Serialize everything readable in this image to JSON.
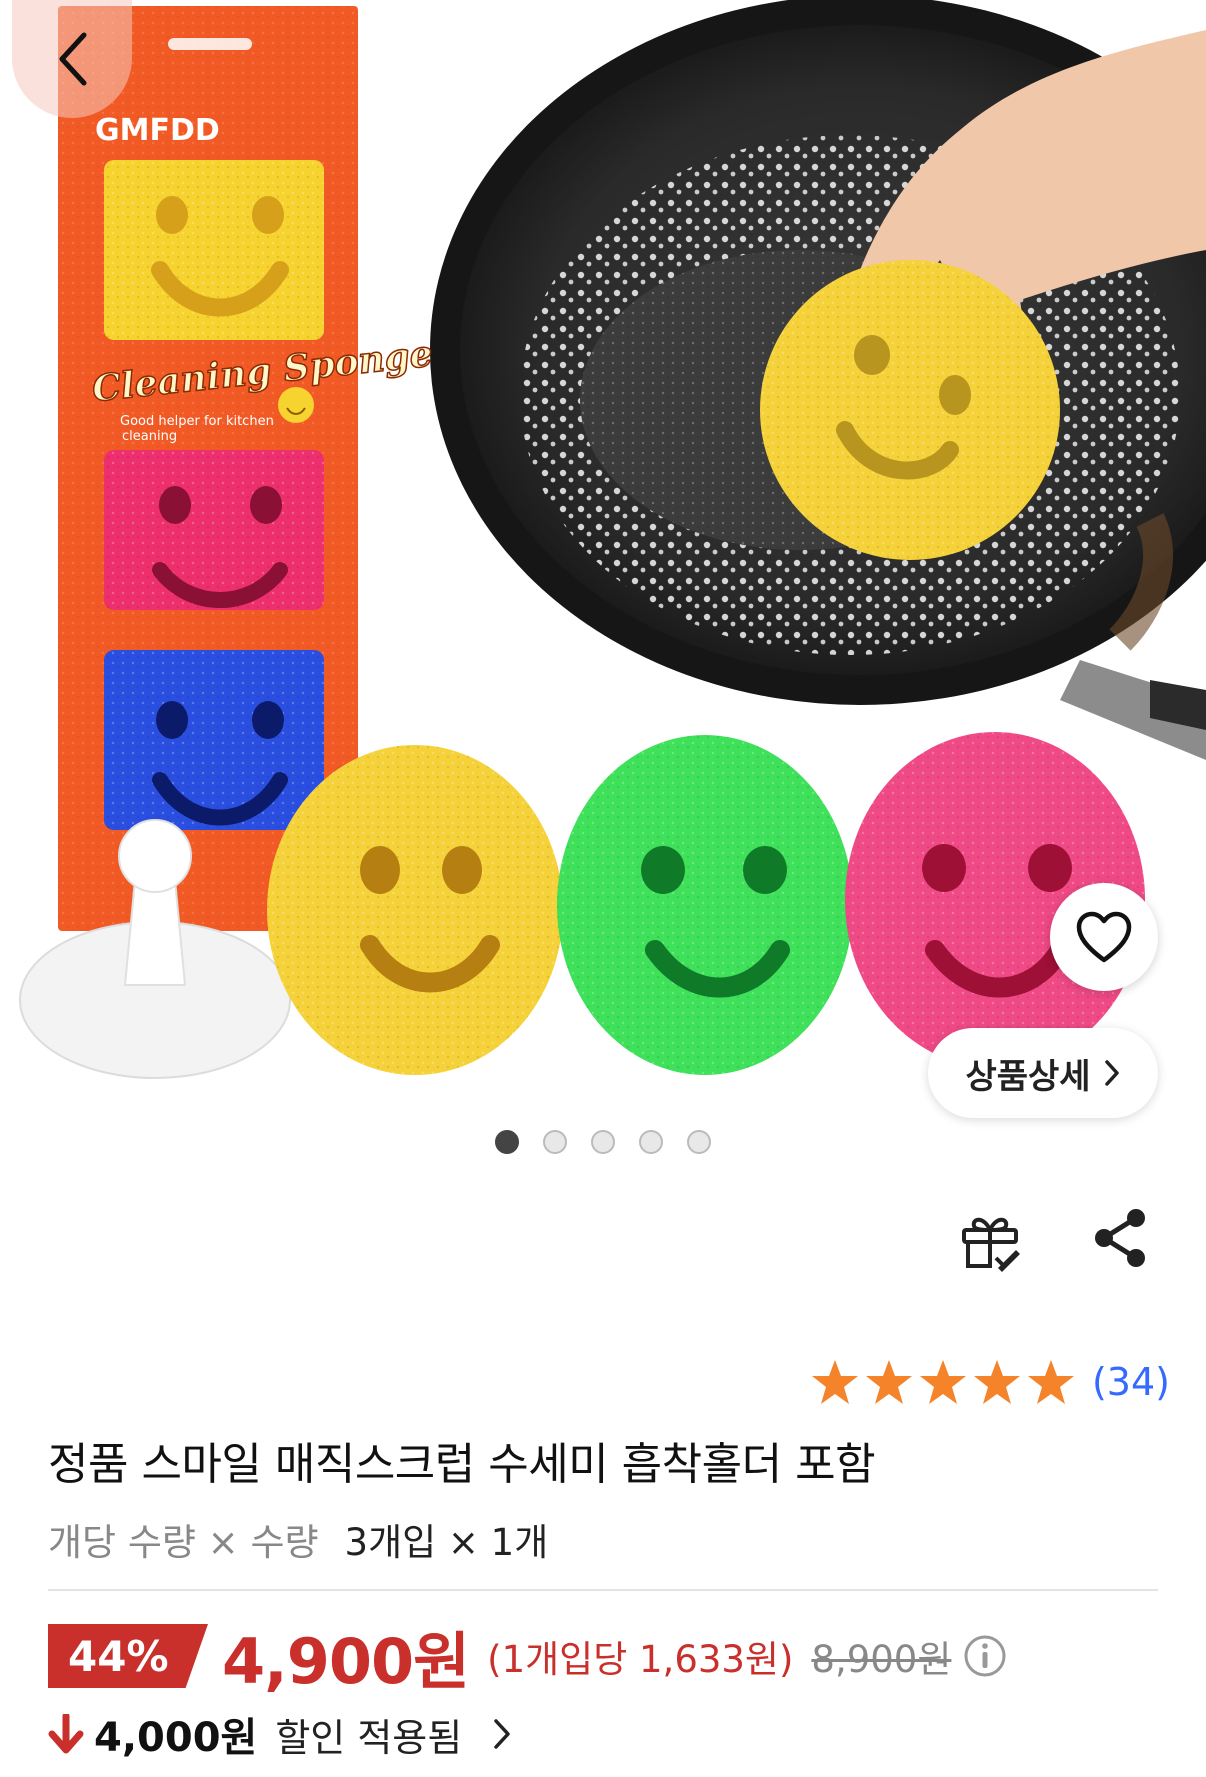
{
  "hero": {
    "box_brand": "GMFDD",
    "box_title": "Cleaning Sponge",
    "box_subtitle_1": "Good helper for kitchen",
    "box_subtitle_2": "cleaning",
    "detail_button_label": "상품상세",
    "carousel": {
      "total": 5,
      "active": 1
    }
  },
  "icons": {
    "back": "chevron-left-icon",
    "wishlist": "heart-icon",
    "gift": "gift-icon",
    "share": "share-icon",
    "info": "info-icon"
  },
  "colors": {
    "accent_red": "#c9302c",
    "rating_blue": "#346aff",
    "star_orange": "#f5832a"
  },
  "rating": {
    "stars": 5,
    "count_text": "(34)"
  },
  "product": {
    "title": "정품 스마일 매직스크럽 수세미 흡착홀더 포함",
    "qty_label": "개당 수량 × 수량",
    "qty_value": "3개입 × 1개"
  },
  "price": {
    "discount_rate": "44%",
    "sale_price": "4,900원",
    "unit_price": "(1개입당 1,633원)",
    "original_price": "8,900원"
  },
  "coupon": {
    "amount": "4,000원",
    "text": "할인 적용됨"
  }
}
